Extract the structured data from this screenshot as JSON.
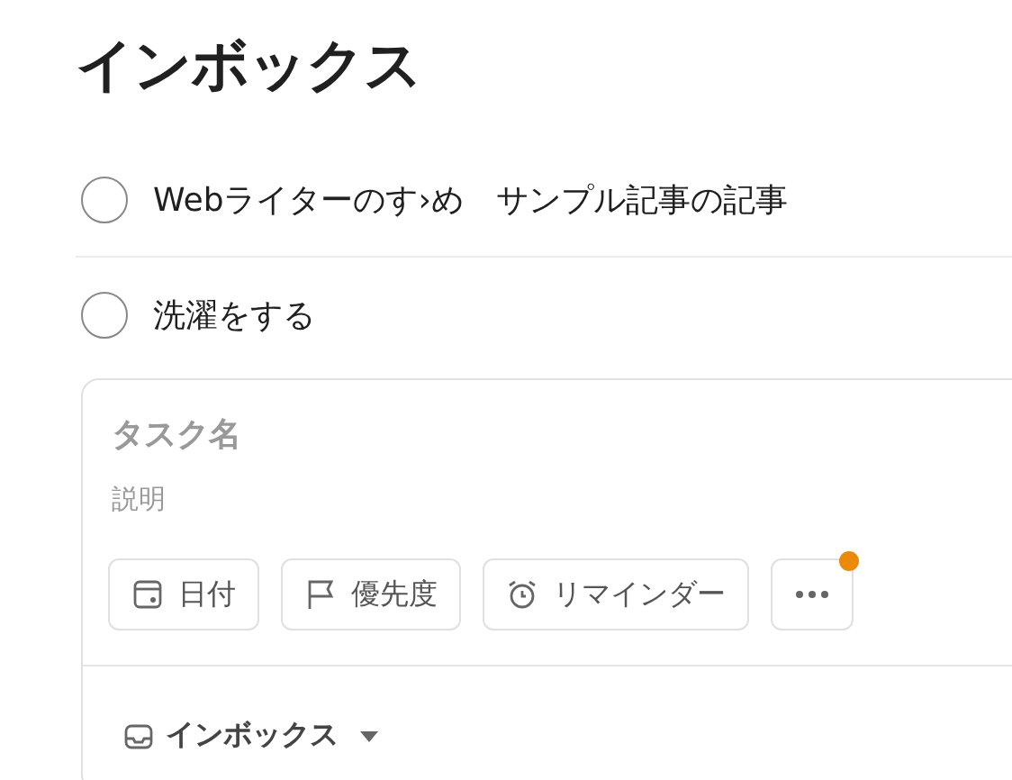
{
  "title": "インボックス",
  "tasks": [
    {
      "name": "Webライターのす›め　サンプル記事の記事",
      "checked": false
    },
    {
      "name": "洗濯をする",
      "checked": false
    }
  ],
  "editor": {
    "task_name": {
      "placeholder": "タスク名"
    },
    "description": {
      "placeholder": "説明"
    },
    "actions": [
      {
        "kind": "date",
        "label": "日付"
      },
      {
        "kind": "priority",
        "label": "優先度"
      },
      {
        "kind": "reminder",
        "label": "リマインダー"
      },
      {
        "kind": "more",
        "badge": true
      }
    ],
    "project": {
      "label": "インボックス"
    }
  }
}
